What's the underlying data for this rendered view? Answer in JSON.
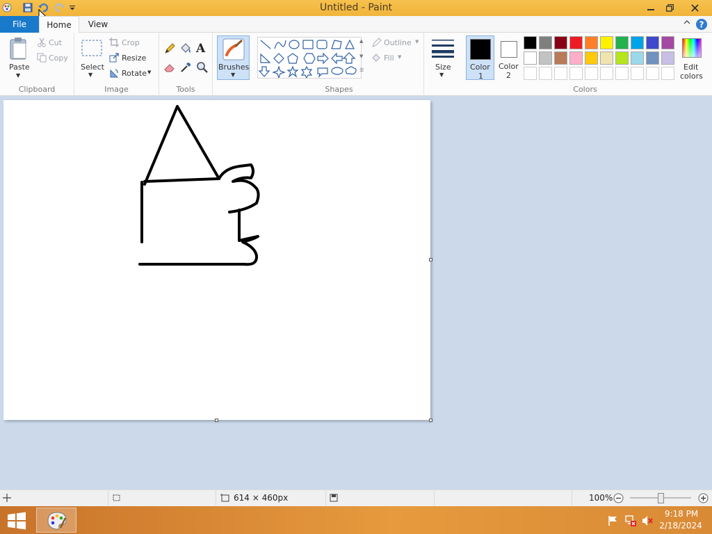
{
  "window": {
    "title": "Untitled - Paint"
  },
  "tabs": {
    "file": "File",
    "home": "Home",
    "view": "View"
  },
  "ribbon": {
    "clipboard": {
      "label": "Clipboard",
      "paste": "Paste",
      "cut": "Cut",
      "copy": "Copy"
    },
    "image": {
      "label": "Image",
      "select": "Select",
      "crop": "Crop",
      "resize": "Resize",
      "rotate": "Rotate"
    },
    "tools": {
      "label": "Tools"
    },
    "brushes": {
      "label": "Brushes"
    },
    "shapes": {
      "label": "Shapes",
      "outline": "Outline",
      "fill": "Fill"
    },
    "size": {
      "label": "Size"
    },
    "colors": {
      "label": "Colors",
      "color1": "Color",
      "color1_num": "1",
      "color2": "Color",
      "color2_num": "2",
      "edit": "Edit",
      "edit2": "colors",
      "color1_value": "#000000",
      "color2_value": "#ffffff",
      "palette_row1": [
        "#000000",
        "#7f7f7f",
        "#880015",
        "#ed1c24",
        "#ff7f27",
        "#fff200",
        "#22b14c",
        "#00a2e8",
        "#3f48cc",
        "#a349a4"
      ],
      "palette_row2": [
        "#ffffff",
        "#c3c3c3",
        "#b97a57",
        "#ffaec9",
        "#ffc90e",
        "#efe4b0",
        "#b5e61d",
        "#99d9ea",
        "#7092be",
        "#c8bfe7"
      ]
    }
  },
  "status": {
    "dimensions": "614 × 460px",
    "zoom": "100%"
  },
  "taskbar": {
    "time": "9:18 PM",
    "date": "2/18/2024"
  }
}
